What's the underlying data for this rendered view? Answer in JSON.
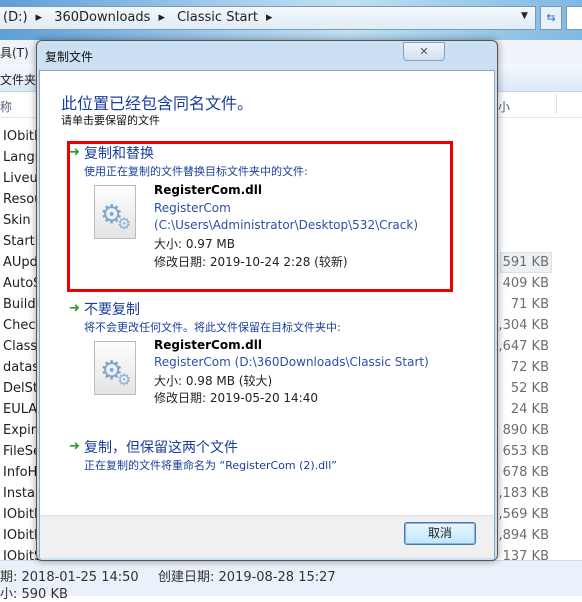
{
  "explorer": {
    "breadcrumb": [
      "(D:)",
      "360Downloads",
      "Classic Start"
    ],
    "menu_partial": "具(T)",
    "toolbar_partial": "文件夹",
    "column_name_partial": "称",
    "column_size_partial": "小",
    "rows": [
      {
        "name": "IObitE",
        "size": ""
      },
      {
        "name": "Langu",
        "size": ""
      },
      {
        "name": "Liveup",
        "size": ""
      },
      {
        "name": "Resou",
        "size": ""
      },
      {
        "name": "Skin",
        "size": ""
      },
      {
        "name": "StartE",
        "size": ""
      },
      {
        "name": "AUpd",
        "size": "591 KB",
        "selected": true
      },
      {
        "name": "AutoS",
        "size": "409 KB"
      },
      {
        "name": "BuildI",
        "size": "71 KB"
      },
      {
        "name": "Check",
        "size": "1,304 KB"
      },
      {
        "name": "Classi",
        "size": "2,647 KB"
      },
      {
        "name": "datas",
        "size": "72 KB"
      },
      {
        "name": "DelSta",
        "size": "52 KB"
      },
      {
        "name": "EULA.",
        "size": "24 KB"
      },
      {
        "name": "Expire",
        "size": "890 KB"
      },
      {
        "name": "FileSe",
        "size": "653 KB"
      },
      {
        "name": "InfoH",
        "size": "678 KB"
      },
      {
        "name": "Instal",
        "size": "2,183 KB"
      },
      {
        "name": "IObitl",
        "size": "2,569 KB"
      },
      {
        "name": "IObitl",
        "size": "2,894 KB"
      },
      {
        "name": "IObitS",
        "size": "137 KB"
      }
    ],
    "status": {
      "modified": "期: 2018-01-25 14:50",
      "created": "创建日期: 2019-08-28 15:27",
      "size": "小: 590 KB"
    }
  },
  "dialog": {
    "title": "复制文件",
    "heading": "此位置已经包含同名文件。",
    "subheading": "请单击要保留的文件",
    "options": [
      {
        "title": "复制和替换",
        "desc": "使用正在复制的文件替换目标文件夹中的文件:",
        "file": "RegisterCom.dll",
        "line1": "RegisterCom",
        "line2": "(C:\\Users\\Administrator\\Desktop\\532\\Crack)",
        "size": "大小: 0.97 MB",
        "date": "修改日期: 2019-10-24 2:28 (较新)"
      },
      {
        "title": "不要复制",
        "desc": "将不会更改任何文件。将此文件保留在目标文件夹中:",
        "file": "RegisterCom.dll",
        "line1": "RegisterCom (D:\\360Downloads\\Classic Start)",
        "size": "大小: 0.98 MB (较大)",
        "date": "修改日期: 2019-05-20 14:40"
      },
      {
        "title": "复制，但保留这两个文件",
        "desc": "正在复制的文件将重命名为 “RegisterCom (2).dll”"
      }
    ],
    "cancel_label": "取消",
    "highlight_color": "#e00000",
    "accent_color": "#1a3e9c"
  }
}
